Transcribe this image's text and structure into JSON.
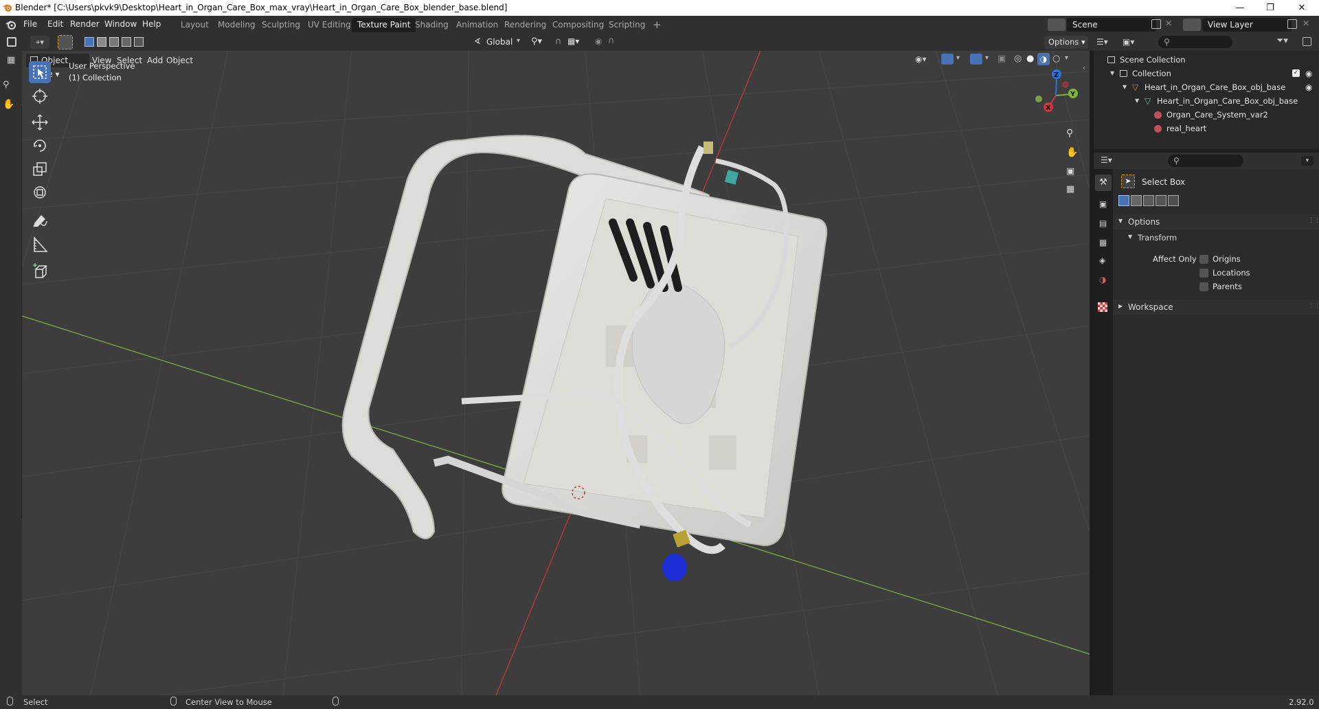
{
  "window": {
    "title": "Blender* [C:\\Users\\pkvk9\\Desktop\\Heart_in_Organ_Care_Box_max_vray\\Heart_in_Organ_Care_Box_blender_base.blend]",
    "controls": [
      "minimize-icon",
      "restore-icon",
      "close-icon"
    ]
  },
  "menubar": {
    "items": [
      "File",
      "Edit",
      "Render",
      "Window",
      "Help"
    ]
  },
  "workspaces": {
    "tabs": [
      "Layout",
      "Modeling",
      "Sculpting",
      "UV Editing",
      "Texture Paint",
      "Shading",
      "Animation",
      "Rendering",
      "Compositing",
      "Scripting"
    ],
    "active": "Texture Paint",
    "add": "+"
  },
  "scene": {
    "label": "Scene",
    "view_layer": "View Layer"
  },
  "tool_header": {
    "transform_orientation": "Global",
    "options": "Options"
  },
  "viewport_header": {
    "mode": "Object Mode",
    "menus": [
      "View",
      "Select",
      "Add",
      "Object"
    ]
  },
  "viewport": {
    "perspective": "User Perspective",
    "collection": "(1) Collection",
    "gizmo_axes": {
      "x": "X",
      "y": "Y",
      "z": "Z"
    },
    "colors": {
      "x_axis": "#c8383e",
      "y_axis": "#7fb53a",
      "z_axis": "#2b72d6",
      "background": "#3d3d3d",
      "grid": "#474747"
    }
  },
  "toolbar": {
    "tools": [
      "select-box-icon",
      "cursor-icon",
      "move-icon",
      "rotate-icon",
      "scale-icon",
      "transform-icon",
      "annotate-icon",
      "measure-icon",
      "add-cube-icon"
    ],
    "active": "select-box-icon"
  },
  "outliner": {
    "rows": [
      {
        "label": "Scene Collection",
        "indent": 0
      },
      {
        "label": "Collection",
        "indent": 1
      },
      {
        "label": "Heart_in_Organ_Care_Box_obj_base",
        "indent": 2
      },
      {
        "label": "Heart_in_Organ_Care_Box_obj_base",
        "indent": 3
      },
      {
        "label": "Organ_Care_System_var2",
        "indent": 4
      },
      {
        "label": "real_heart",
        "indent": 4
      }
    ]
  },
  "properties": {
    "tool_name": "Select Box",
    "sections": {
      "options": "Options",
      "transform": "Transform",
      "affect_only": "Affect Only",
      "checkboxes": [
        "Origins",
        "Locations",
        "Parents"
      ],
      "workspace": "Workspace"
    }
  },
  "statusbar": {
    "left": "Select",
    "middle": "Center View to Mouse",
    "version": "2.92.0"
  }
}
